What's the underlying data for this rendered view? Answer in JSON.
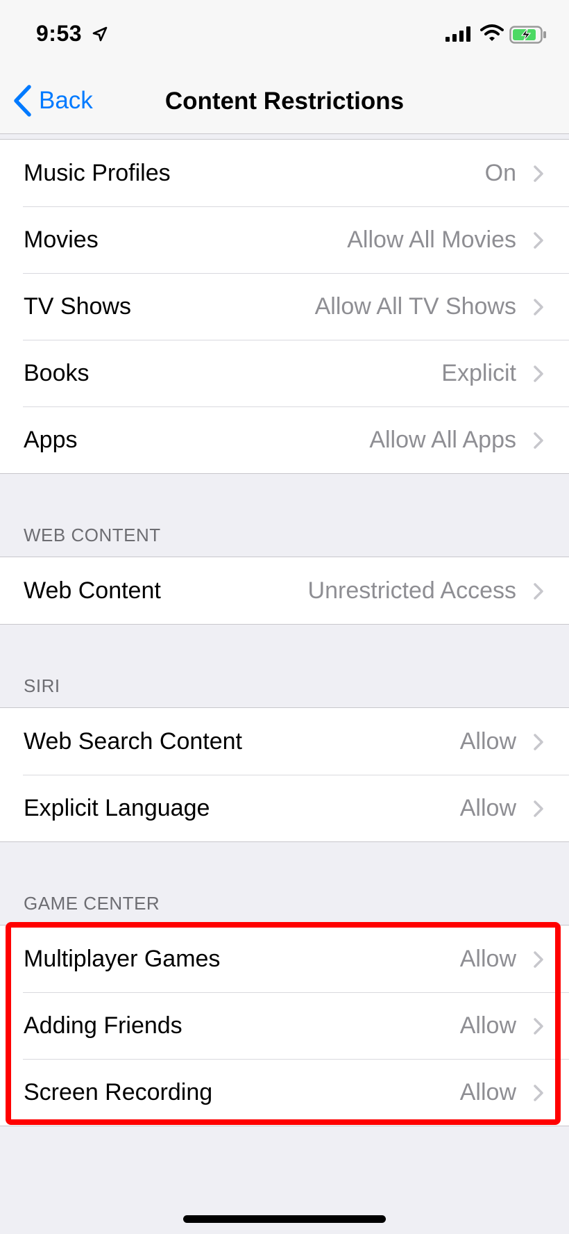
{
  "status_bar": {
    "time": "9:53",
    "icons": [
      "location-arrow-icon",
      "cellular-signal-icon",
      "wifi-icon",
      "battery-charging-icon"
    ],
    "battery_color": "#4cd964"
  },
  "nav": {
    "back_label": "Back",
    "title": "Content Restrictions",
    "accent_color": "#007aff"
  },
  "groups": {
    "store": {
      "rows": [
        {
          "label": "Music Profiles",
          "value": "On"
        },
        {
          "label": "Movies",
          "value": "Allow All Movies"
        },
        {
          "label": "TV Shows",
          "value": "Allow All TV Shows"
        },
        {
          "label": "Books",
          "value": "Explicit"
        },
        {
          "label": "Apps",
          "value": "Allow All Apps"
        }
      ]
    },
    "web": {
      "header": "WEB CONTENT",
      "rows": [
        {
          "label": "Web Content",
          "value": "Unrestricted Access"
        }
      ]
    },
    "siri": {
      "header": "SIRI",
      "rows": [
        {
          "label": "Web Search Content",
          "value": "Allow"
        },
        {
          "label": "Explicit Language",
          "value": "Allow"
        }
      ]
    },
    "game_center": {
      "header": "GAME CENTER",
      "highlight_color": "#ff0000",
      "rows": [
        {
          "label": "Multiplayer Games",
          "value": "Allow"
        },
        {
          "label": "Adding Friends",
          "value": "Allow"
        },
        {
          "label": "Screen Recording",
          "value": "Allow"
        }
      ]
    }
  }
}
